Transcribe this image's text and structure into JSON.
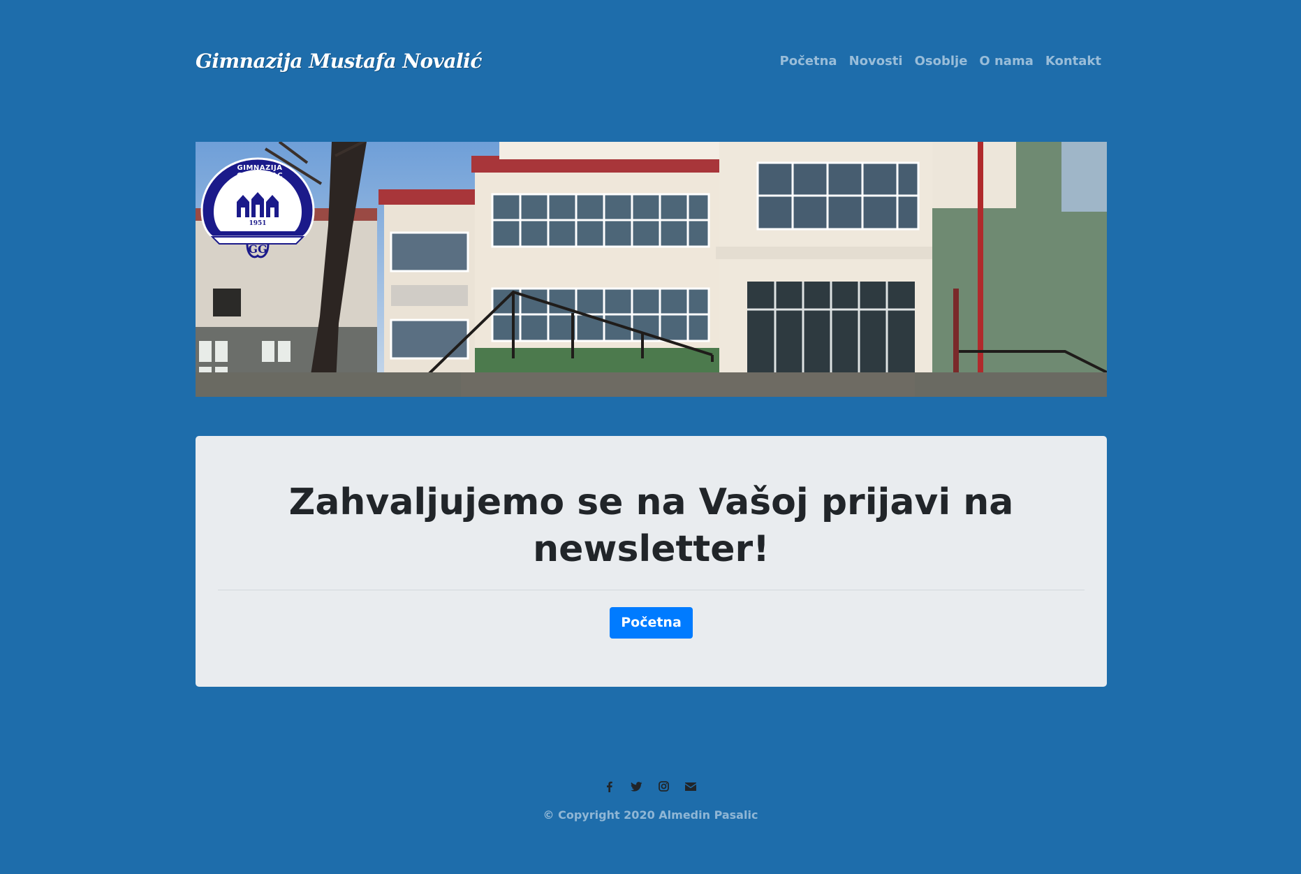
{
  "header": {
    "brand": "Gimnazija Mustafa Novalić",
    "nav": [
      {
        "label": "Početna"
      },
      {
        "label": "Novosti"
      },
      {
        "label": "Osoblje"
      },
      {
        "label": "O nama"
      },
      {
        "label": "Kontakt"
      }
    ]
  },
  "hero": {
    "logo_text": "GIMNAZIJA GRADAČAC",
    "logo_year": "1951",
    "logo_monogram": "GG"
  },
  "jumbotron": {
    "title": "Zahvaljujemo se na Vašoj prijavi na newsletter!",
    "button_label": "Početna"
  },
  "footer": {
    "icons": [
      "facebook-icon",
      "twitter-icon",
      "instagram-icon",
      "envelope-icon"
    ],
    "copyright": "© Copyright 2020 Almedin Pasalic"
  },
  "colors": {
    "page_background": "#1e6dab",
    "jumbotron_background": "#e9ecef",
    "primary": "#007bff",
    "text_dark": "#212529"
  }
}
